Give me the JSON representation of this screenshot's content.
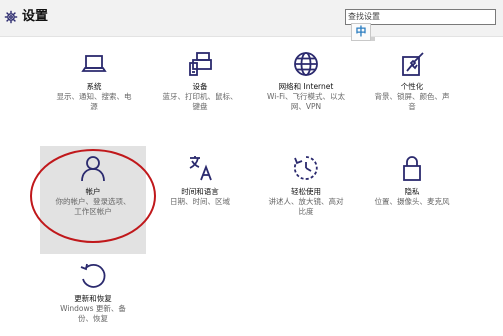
{
  "window": {
    "title": "设置"
  },
  "search": {
    "placeholder": "查找设置",
    "value": ""
  },
  "ime": {
    "label": "中"
  },
  "tiles": [
    {
      "id": "system",
      "icon": "laptop-icon",
      "title": "系统",
      "desc": "显示、通知、搜索、电\n源"
    },
    {
      "id": "devices",
      "icon": "devices-icon",
      "title": "设备",
      "desc": "蓝牙、打印机、鼠标、\n键盘"
    },
    {
      "id": "network",
      "icon": "globe-icon",
      "title": "网络和 Internet",
      "desc": "Wi-Fi、飞行模式、以太\n网、VPN"
    },
    {
      "id": "personalization",
      "icon": "paintbrush-icon",
      "title": "个性化",
      "desc": "背景、锁屏、颜色、声\n音"
    },
    {
      "id": "accounts",
      "icon": "person-icon",
      "title": "帐户",
      "desc": "你的帐户、登录选项、\n工作区帐户"
    },
    {
      "id": "time-language",
      "icon": "time-language-icon",
      "title": "时间和语言",
      "desc": "日期、时间、区域"
    },
    {
      "id": "ease-of-access",
      "icon": "ease-of-access-icon",
      "title": "轻松使用",
      "desc": "讲述人、放大镜、高对\n比度"
    },
    {
      "id": "privacy",
      "icon": "lock-icon",
      "title": "隐私",
      "desc": "位置、摄像头、麦克风"
    },
    {
      "id": "update-security",
      "icon": "refresh-icon",
      "title": "更新和恢复",
      "desc": "Windows 更新、备\n份、恢复"
    }
  ],
  "colors": {
    "icon": "#2b2a6e",
    "highlight": "#e2e2e2",
    "annotation": "#c0181b"
  }
}
